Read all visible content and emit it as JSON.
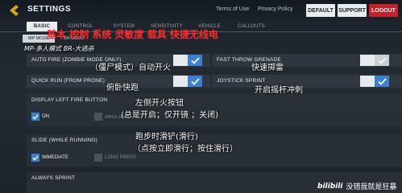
{
  "header": {
    "title": "SETTINGS",
    "links": [
      "Terms of Use",
      "Privacy Policy"
    ],
    "buttons": {
      "default": "DEFAULT",
      "support": "SUPPORT",
      "logout": "LOGOUT"
    }
  },
  "tabs": [
    "BASIC",
    "CONTROL",
    "SYSTEM",
    "SENSITIVITY",
    "VEHICLE",
    "CALLOUTS"
  ],
  "active_tab": "BASIC",
  "subtabs": {
    "active": "MP MODE",
    "inactive": "BR MODE"
  },
  "rows": [
    {
      "label": "AUTO FIRE (ZOMBIE MODE ONLY)",
      "state": "on"
    },
    {
      "label": "FAST THROW GRENADE",
      "state": "off"
    },
    {
      "label": "QUICK RUN (FROM PRONE)",
      "state": "on"
    },
    {
      "label": "JOYSTICK SPRINT",
      "state": "on"
    }
  ],
  "sections": {
    "left_fire": {
      "title": "DISPLAY LEFT FIRE BUTTON",
      "options": [
        "ON",
        "WHILE ADS"
      ]
    },
    "slide": {
      "title": "SLIDE (WHILE RUNNING)",
      "options": [
        "IMMEDIATE",
        "LONG PRESS"
      ]
    },
    "sprint": {
      "title": "ALWAYS SPRINT"
    }
  },
  "annotations": {
    "tab_cn": "基本  控制  系统  灵敏度  载具  快捷无线电",
    "mode_cn": "MP-多人模式  BR-大逃杀",
    "auto_fire_cn": "（僵尸模式）自动开火",
    "quick_run_cn": "俯卧快跑",
    "grenade_cn": "快速掷雷",
    "joystick_cn": "开启摇杆冲刺",
    "left_fire_cn": "左侧开火按钮",
    "left_fire_detail_cn": "(总是开启；仅开镜 ；关闭)",
    "slide_cn": "跑步时滑铲(滑行)",
    "slide_detail_cn": "（点按立即滑行；按住滑行）"
  },
  "watermark": {
    "logo": "bilibili",
    "text": "没错我就是狂暴"
  },
  "colors": {
    "accent": "#3c7fd6",
    "logout": "#c9202a",
    "annotation_red": "#ff2a2a"
  }
}
